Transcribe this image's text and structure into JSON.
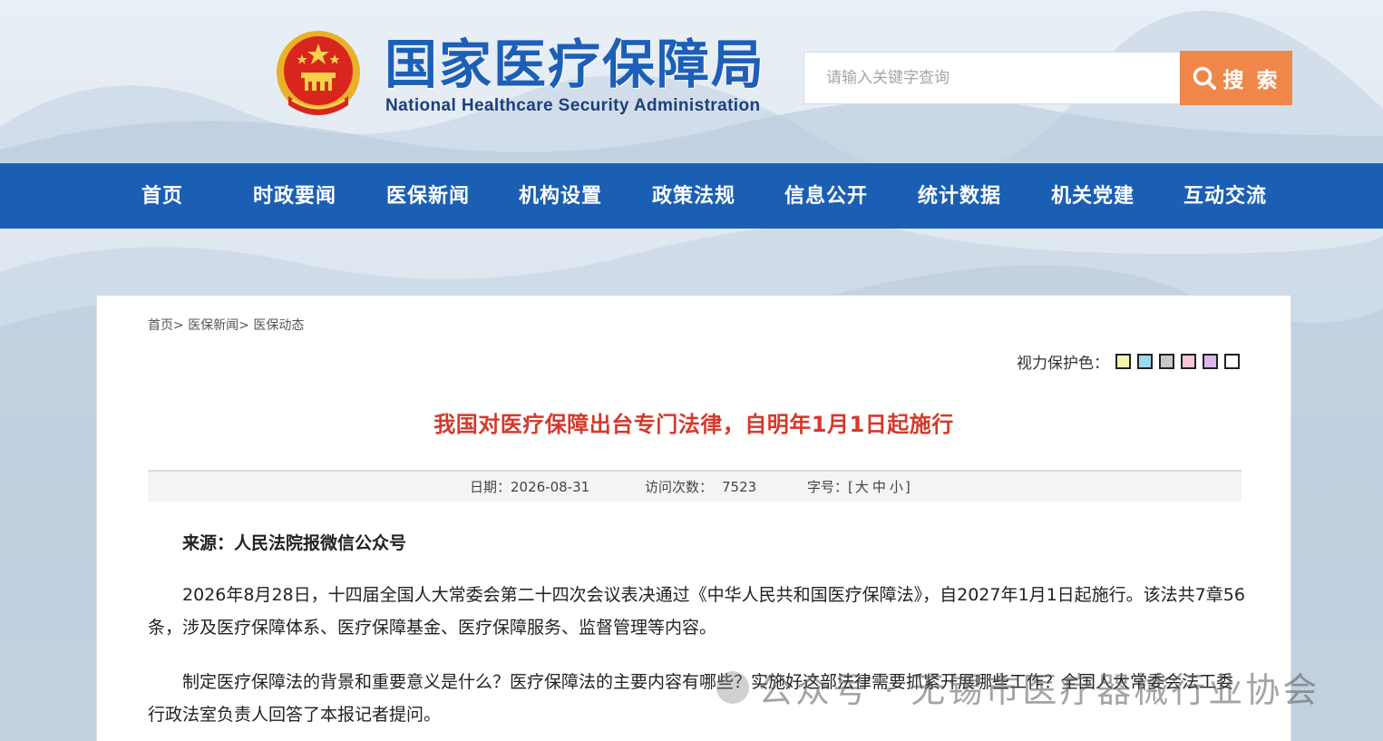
{
  "header": {
    "site_title": "国家医疗保障局",
    "site_subtitle": "National Healthcare Security Administration",
    "search_placeholder": "请输入关键字查询",
    "search_label": "搜 索"
  },
  "nav": {
    "items": [
      "首页",
      "时政要闻",
      "医保新闻",
      "机构设置",
      "政策法规",
      "信息公开",
      "统计数据",
      "机关党建",
      "互动交流"
    ]
  },
  "breadcrumb": {
    "items": [
      "首页>",
      "医保新闻>",
      "医保动态"
    ]
  },
  "eye_care": {
    "label": "视力保护色：",
    "swatches": [
      "#f7f3b0",
      "#9fd8f0",
      "#c8c8c8",
      "#f6c8d6",
      "#d8b8ea",
      "#ffffff"
    ]
  },
  "article": {
    "title": "我国对医疗保障出台专门法律，自明年1月1日起施行",
    "date_label": "日期：",
    "date": "2026-08-31",
    "visits_label": "访问次数：",
    "visits": "7523",
    "font_label": "字号：",
    "font_open": "[",
    "font_large": "大",
    "font_medium": "中",
    "font_small": "小",
    "font_close": "]",
    "source": "来源：人民法院报微信公众号",
    "paragraphs": [
      "2026年8月28日，十四届全国人大常委会第二十四次会议表决通过《中华人民共和国医疗保障法》，自2027年1月1日起施行。该法共7章56条，涉及医疗保障体系、医疗保障基金、医疗保障服务、监督管理等内容。",
      "制定医疗保障法的背景和重要意义是什么？医疗保障法的主要内容有哪些？实施好这部法律需要抓紧开展哪些工作？全国人大常委会法工委行政法室负责人回答了本报记者提问。"
    ]
  },
  "watermark": {
    "text": "公众号 · 无锡市医疗器械行业协会"
  }
}
